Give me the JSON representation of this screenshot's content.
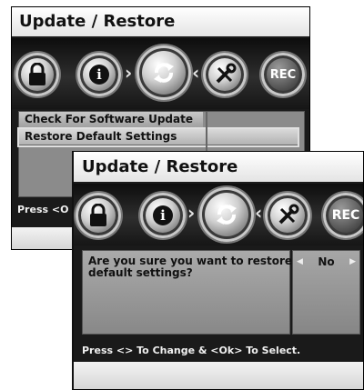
{
  "back_screen": {
    "title": "Update / Restore",
    "menu_items": [
      "Check For Software Update",
      "Restore Default Settings"
    ],
    "hint_partial": "Press <O"
  },
  "front_screen": {
    "title": "Update / Restore",
    "prompt": "Are you sure you want to restore default settings?",
    "value": "No",
    "hint": "Press <> To Change & <Ok> To Select."
  },
  "icons": {
    "lock": "lock-icon",
    "info": "info-icon",
    "update": "update-restore-icon",
    "tools": "tools-icon",
    "rec": "REC"
  }
}
